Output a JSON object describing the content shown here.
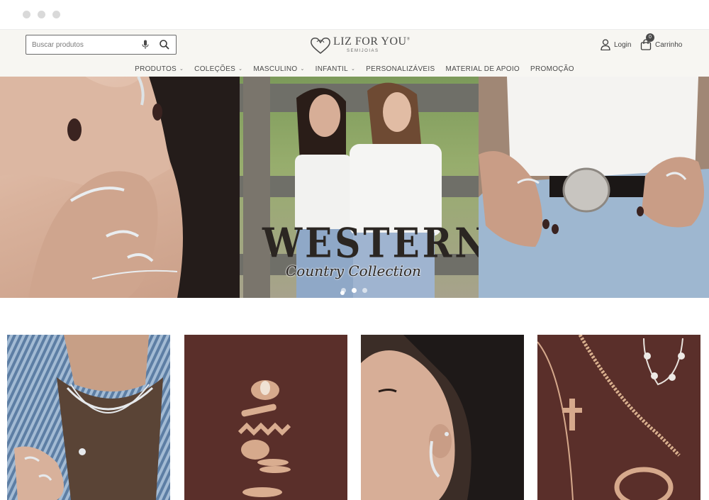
{
  "search": {
    "placeholder": "Buscar produtos"
  },
  "brand": {
    "name": "LIZ FOR YOU",
    "trademark": "®",
    "subtitle": "SEMIJOIAS"
  },
  "account": {
    "login_label": "Login",
    "cart_label": "Carrinho",
    "cart_count": "0"
  },
  "nav": {
    "items": [
      {
        "label": "PRODUTOS",
        "dropdown": true
      },
      {
        "label": "COLEÇÕES",
        "dropdown": true
      },
      {
        "label": "MASCULINO",
        "dropdown": true
      },
      {
        "label": "INFANTIL",
        "dropdown": true
      },
      {
        "label": "PERSONALIZÁVEIS",
        "dropdown": false
      },
      {
        "label": "MATERIAL DE APOIO",
        "dropdown": false
      },
      {
        "label": "PROMOÇÃO",
        "dropdown": false
      }
    ]
  },
  "hero": {
    "title": "WESTERN",
    "subtitle": "Country Collection",
    "slide_count": 3,
    "active_slide": 1
  },
  "categories": [
    {
      "image": "necklaces-and-rings-on-model"
    },
    {
      "image": "gold-rings-on-brown"
    },
    {
      "image": "ear-cuff-on-model"
    },
    {
      "image": "gold-necklaces-on-brown"
    }
  ],
  "colors": {
    "header_bg": "#f7f6f2",
    "text": "#4a4a4a",
    "product_bg": "#5a2f2a"
  }
}
